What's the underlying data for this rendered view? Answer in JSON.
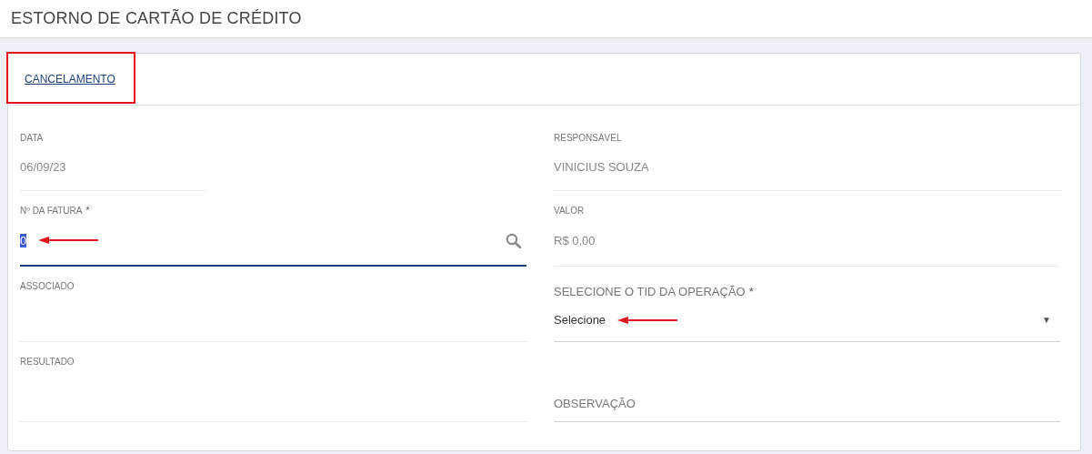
{
  "page": {
    "title": "ESTORNO DE CARTÃO DE CRÉDITO"
  },
  "tabs": [
    {
      "label": "CANCELAMENTO",
      "selected": true,
      "annotated": true
    }
  ],
  "form": {
    "left": [
      {
        "kind": "date",
        "label": "DATA",
        "value": "06/09/23"
      },
      {
        "kind": "search",
        "label": "Nº DA FATURA",
        "required_mark": "*",
        "value": "0",
        "focused": true,
        "highlighted": true,
        "arrow": true
      },
      {
        "kind": "readonly",
        "label": "ASSOCIADO"
      },
      {
        "kind": "readonly",
        "label": "RESULTADO"
      }
    ],
    "right": [
      {
        "kind": "readonly",
        "label": "RESPONSÁVEL",
        "value": "VINICIUS SOUZA"
      },
      {
        "kind": "readonly",
        "label": "VALOR",
        "value": "R$ 0,00"
      },
      {
        "kind": "select",
        "label": "SELECIONE O TID DA OPERAÇÃO",
        "required_mark": "*",
        "value": "Selecione",
        "arrow": true,
        "caret": "▼"
      },
      {
        "kind": "textarea",
        "placeholder": "OBSERVAÇÃO"
      }
    ]
  }
}
